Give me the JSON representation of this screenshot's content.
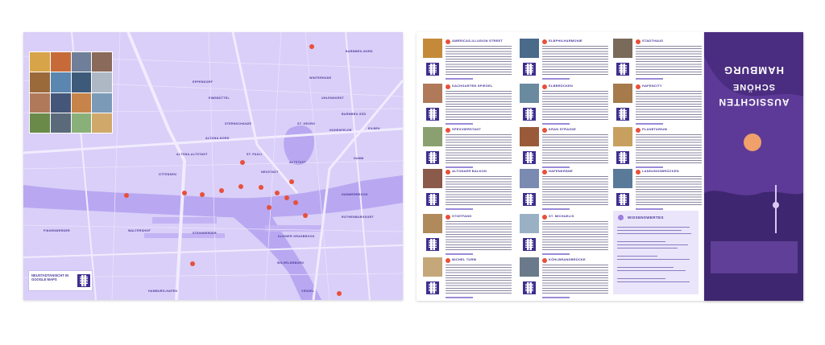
{
  "map": {
    "districts": [
      "BARMBEK-NORD",
      "WINTERHUDE",
      "UHLENHORST",
      "EPPENDORF",
      "BARMBEK-SÜD",
      "EIMSBÜTTEL",
      "HOHENFELDE",
      "ALTONA-NORD",
      "ST. PAULI",
      "STERNSCHANZE",
      "ST. GEORG",
      "EILBEK",
      "HAMM",
      "ALTONA-ALTSTADT",
      "NEUSTADT",
      "HAMMERBROOK",
      "ALTSTADT",
      "ROTHENBURGSORT",
      "OTTENSEN",
      "STEINWERDER",
      "WILHELMSBURG",
      "WALTERSHOF",
      "FINKENWERDER",
      "KLEINER GRASBROOK",
      "VEDDEL",
      "HAMBURG-HAFEN"
    ],
    "qr_label": "NEUSTADTANSICHT IN GOOGLE MAPS"
  },
  "guide": {
    "entries": [
      {
        "title": "AMERICAS-ILLUSION STREET"
      },
      {
        "title": "ELBPHILHARMONIE"
      },
      {
        "title": "STADTHAUS"
      },
      {
        "title": "DACHGARTEN SPIEGEL"
      },
      {
        "title": "ELBBRÜCKEN"
      },
      {
        "title": "HAFENCITY"
      },
      {
        "title": "SPEICHERSTADT"
      },
      {
        "title": "KRAN STRASSE"
      },
      {
        "title": "PLANETARIUM"
      },
      {
        "title": "ALTONAER BALKON"
      },
      {
        "title": "HAFENKRÄNE"
      },
      {
        "title": "LANDUNGSBRÜCKEN"
      },
      {
        "title": "STINTFANG"
      },
      {
        "title": "ST. MICHAELIS"
      },
      {
        "title": "MICHEL TURM"
      },
      {
        "title": "KÖHLBRANDBRÜCKE"
      }
    ],
    "tips_heading": "WISSENSWERTES"
  },
  "cover": {
    "line1": "HAMBURG",
    "line2": "SCHÖNE",
    "line3": "AUSSICHTEN"
  },
  "colors": {
    "accent": "#4b3a99",
    "map_bg": "#d9cff8",
    "marker": "#e8503a",
    "cover": "#6a3ea8"
  }
}
